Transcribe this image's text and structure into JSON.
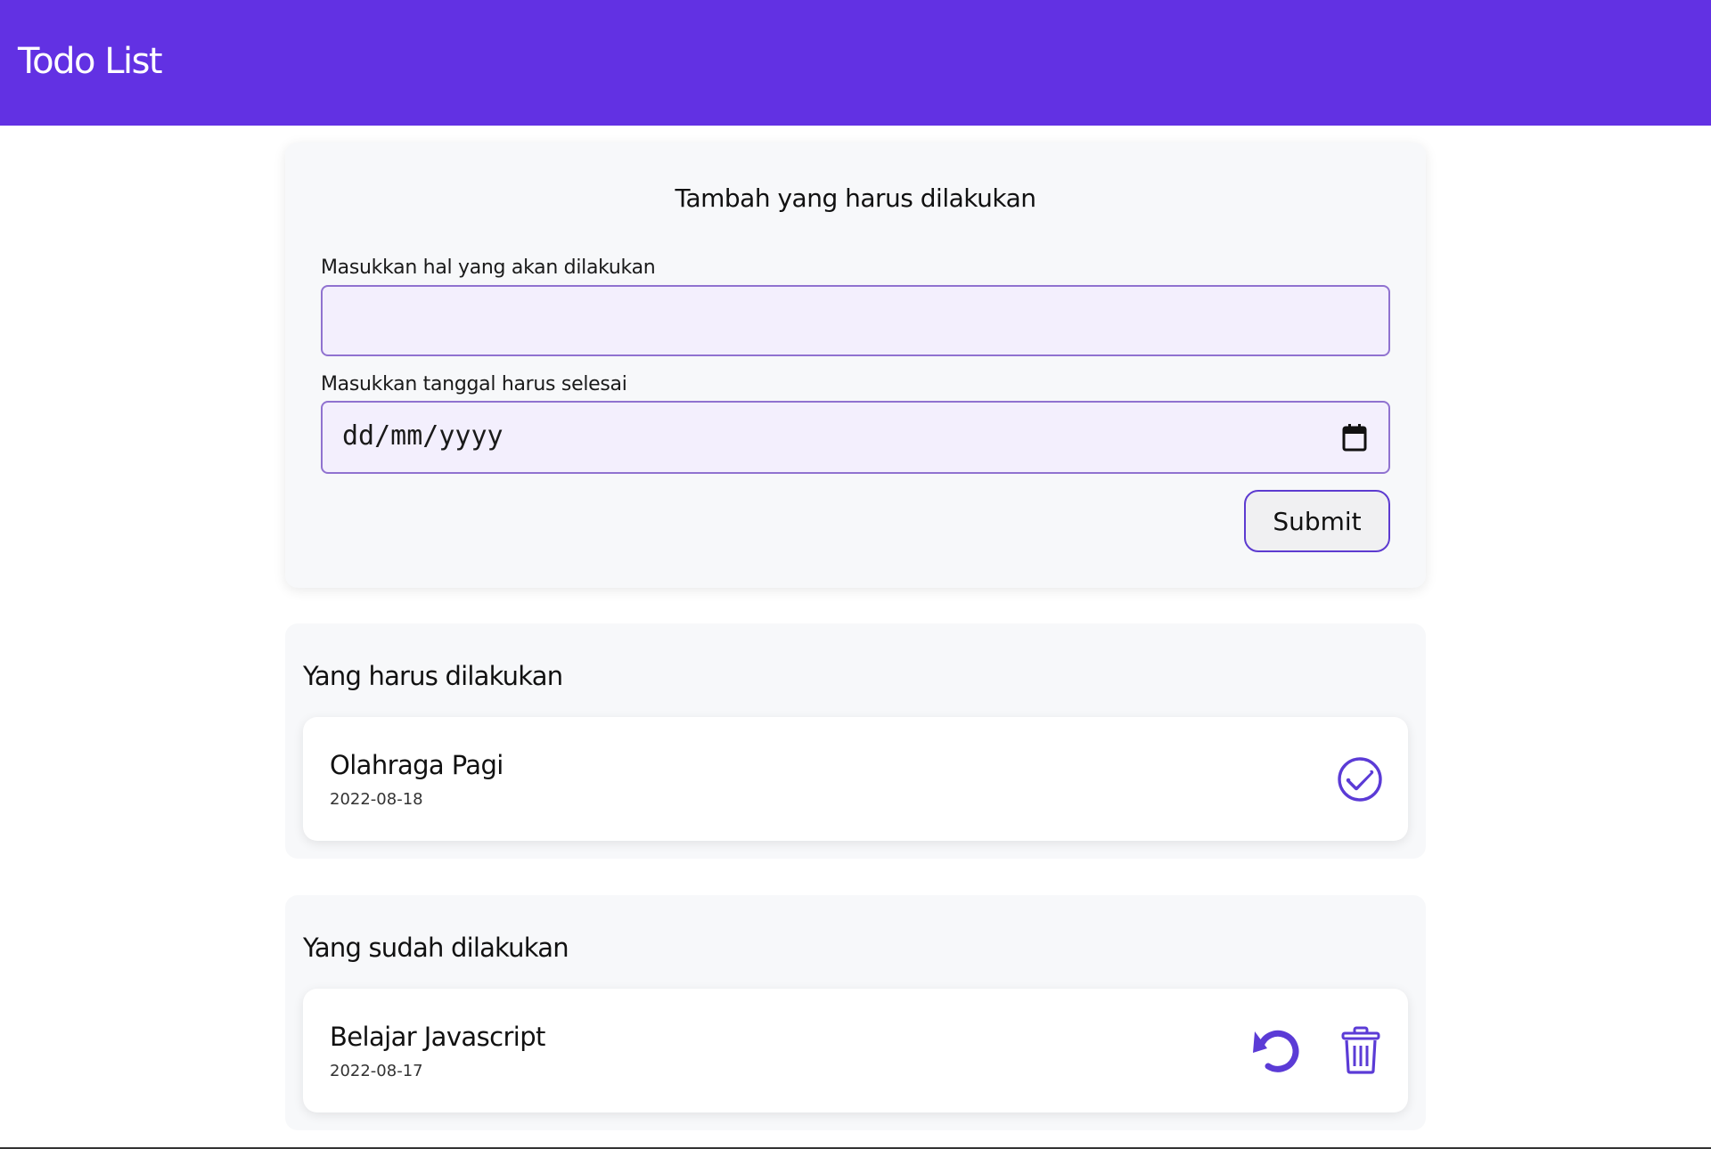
{
  "header": {
    "title": "Todo List"
  },
  "form": {
    "heading": "Tambah yang harus dilakukan",
    "title_label": "Masukkan hal yang akan dilakukan",
    "title_value": "",
    "date_label": "Masukkan tanggal harus selesai",
    "date_placeholder": "dd/mm/yyyy",
    "submit_label": "Submit"
  },
  "incomplete": {
    "heading": "Yang harus dilakukan",
    "items": [
      {
        "title": "Olahraga Pagi",
        "date": "2022-08-18"
      }
    ]
  },
  "completed": {
    "heading": "Yang sudah dilakukan",
    "items": [
      {
        "title": "Belajar Javascript",
        "date": "2022-08-17"
      }
    ]
  },
  "colors": {
    "primary": "#6231e3",
    "accent": "#5b3bd6",
    "field_bg": "#f3effd",
    "card_bg": "#f7f8fa"
  },
  "icons": {
    "calendar": "calendar-icon",
    "check": "check-circle-icon",
    "undo": "undo-icon",
    "trash": "trash-icon"
  }
}
